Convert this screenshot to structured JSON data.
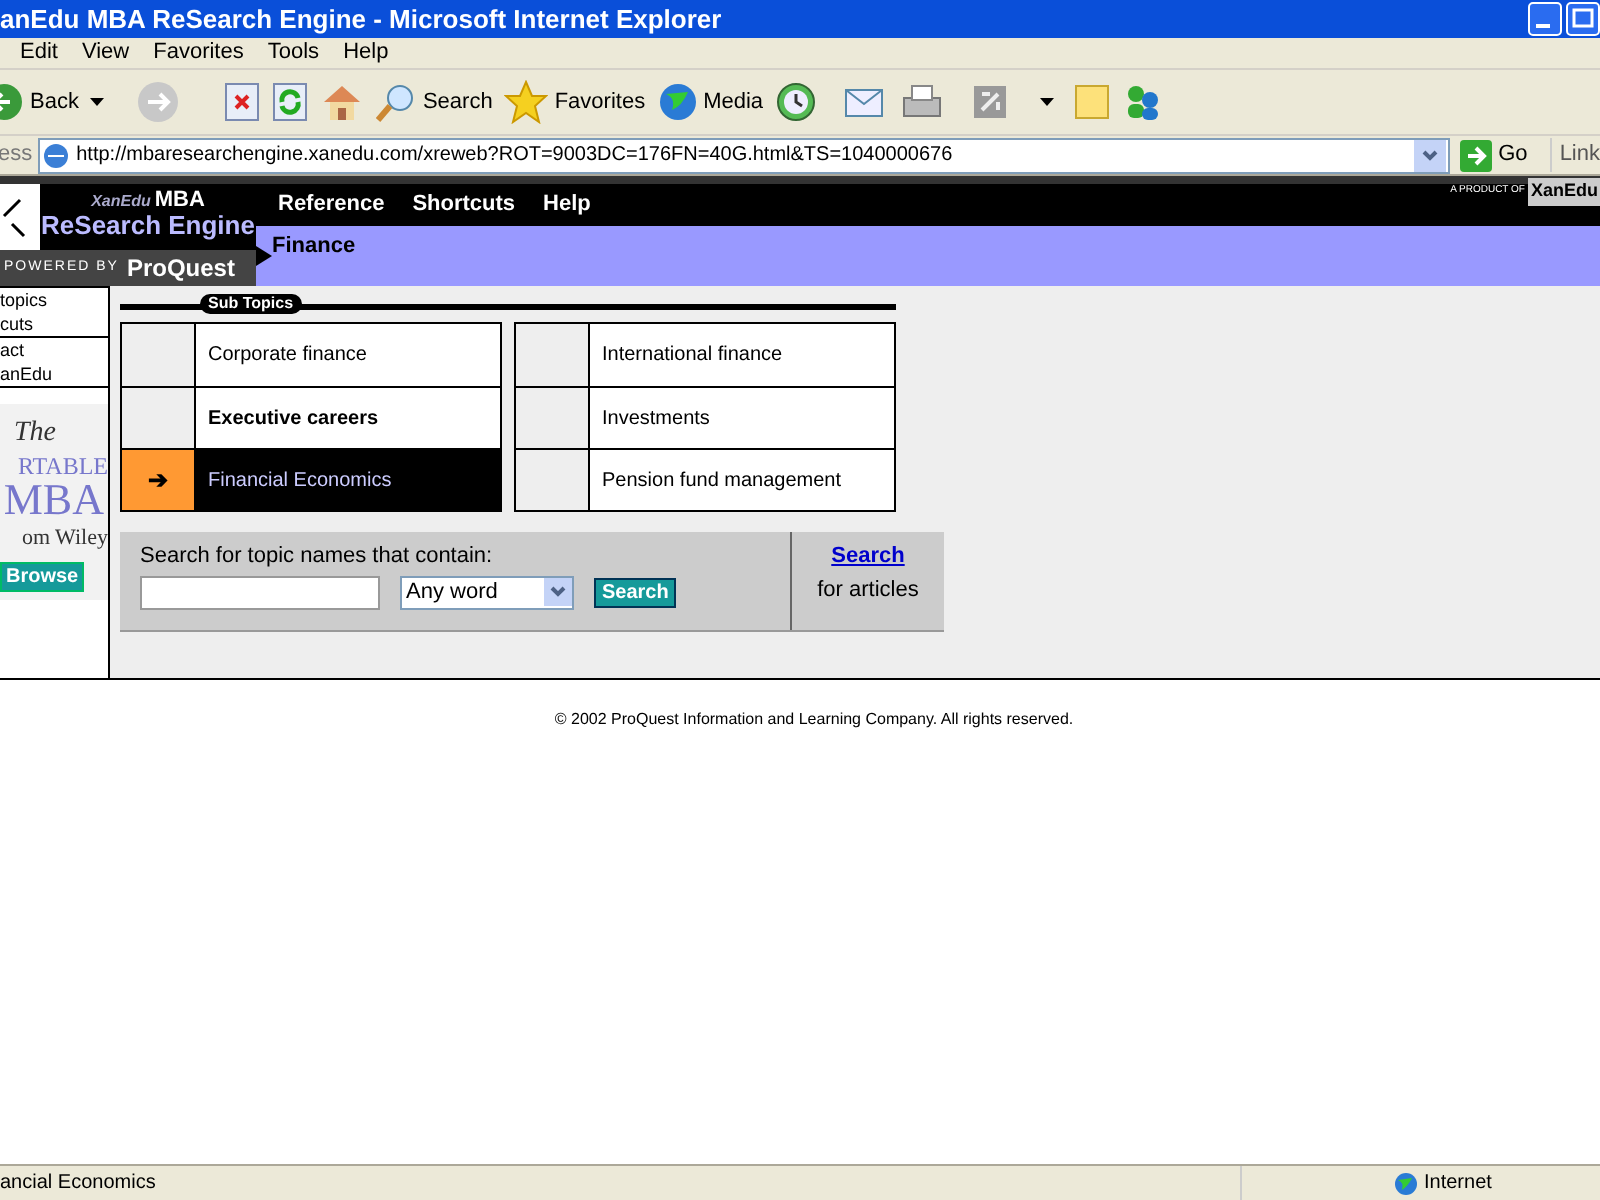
{
  "window": {
    "title": "anEdu MBA ReSearch Engine - Microsoft Internet Explorer"
  },
  "menu": [
    "Edit",
    "View",
    "Favorites",
    "Tools",
    "Help"
  ],
  "toolbar": {
    "back": "Back",
    "search": "Search",
    "favorites": "Favorites",
    "media": "Media"
  },
  "address": {
    "label": "ess",
    "url": "http://mbaresearchengine.xanedu.com/xreweb?ROT=9003DC=176FN=40G.html&TS=1040000676",
    "go": "Go",
    "links": "Link"
  },
  "site": {
    "logo_brand": "XanEdu",
    "logo_mba": "MBA",
    "logo_title": "ReSearch Engine",
    "powered": "POWERED BY",
    "proquest": "ProQuest",
    "product_of": "A PRODUCT OF",
    "product_brand": "XanEdu",
    "nav": [
      "Reference",
      "Shortcuts",
      "Help"
    ],
    "breadcrumb": "Finance"
  },
  "sidebar": {
    "links": [
      "topics",
      "cuts",
      "act",
      "anEdu"
    ],
    "ad": {
      "line1": "The",
      "line2": "RTABLE",
      "line3": "MBA",
      "line4": "om Wiley",
      "button": "Browse"
    }
  },
  "subtopics": {
    "label": "Sub Topics",
    "columns": [
      [
        {
          "label": "Corporate finance",
          "selected": false
        },
        {
          "label": "Executive careers",
          "selected": false
        },
        {
          "label": "Financial Economics",
          "selected": true
        }
      ],
      [
        {
          "label": "International finance",
          "selected": false
        },
        {
          "label": "Investments",
          "selected": false
        },
        {
          "label": "Pension fund management",
          "selected": false
        }
      ]
    ],
    "arrow": "➔"
  },
  "search": {
    "label": "Search for topic names that contain:",
    "mode": "Any word",
    "button": "Search",
    "link": "Search",
    "link_note": "for articles"
  },
  "footer": "© 2002 ProQuest Information and Learning Company. All rights reserved.",
  "status_bar": {
    "text": "ancial Economics",
    "zone": "Internet"
  }
}
